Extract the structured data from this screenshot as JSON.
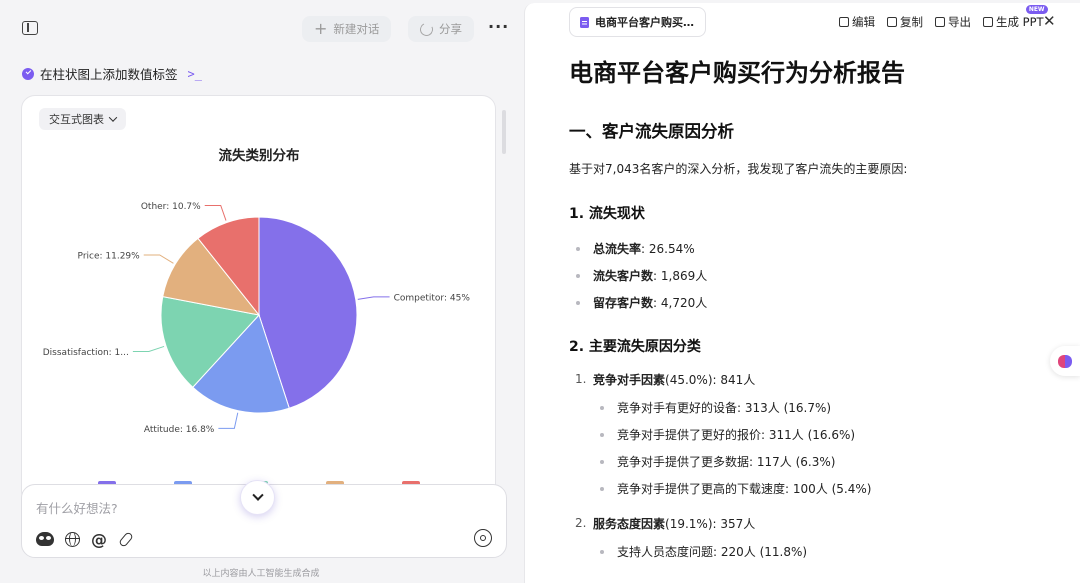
{
  "left": {
    "new_chat": "新建对话",
    "share": "分享",
    "more": "···",
    "task_title": "在柱状图上添加数值标签",
    "task_term_glyph": ">_",
    "chart_mode": "交互式图表",
    "composer_placeholder": "有什么好想法?",
    "ai_note": "以上内容由人工智能生成合成"
  },
  "chart_data": {
    "type": "pie",
    "title": "流失类别分布",
    "slices": [
      {
        "name": "Competitor",
        "label": "Competitor: 45%",
        "value": 45.0,
        "color": "#8470ea"
      },
      {
        "name": "Attitude",
        "label": "Attitude: 16.8%",
        "value": 16.8,
        "color": "#7b9bf0"
      },
      {
        "name": "Dissatisfaction",
        "label": "Dissatisfaction: 1...",
        "value": 16.2,
        "color": "#7dd4b1"
      },
      {
        "name": "Price",
        "label": "Price: 11.29%",
        "value": 11.29,
        "color": "#e2b07e"
      },
      {
        "name": "Other",
        "label": "Other: 10.7%",
        "value": 10.7,
        "color": "#e8706c"
      }
    ]
  },
  "right": {
    "tab_title": "电商平台客户购买…",
    "actions": {
      "edit": "编辑",
      "copy": "复制",
      "export": "导出",
      "ppt": "生成 PPT",
      "new_badge": "NEW"
    },
    "close": "✕",
    "doc": {
      "title": "电商平台客户购买行为分析报告",
      "h2": "一、客户流失原因分析",
      "intro": "基于对7,043名客户的深入分析，我发现了客户流失的主要原因:",
      "s1_title": "1. 流失现状",
      "s1_items": [
        {
          "label": "总流失率",
          "value": ": 26.54%"
        },
        {
          "label": "流失客户数",
          "value": ": 1,869人"
        },
        {
          "label": "留存客户数",
          "value": ": 4,720人"
        }
      ],
      "s2_title": "2. 主要流失原因分类",
      "s2_1_num": "1.",
      "s2_1_label": "竞争对手因素",
      "s2_1_value": " (45.0%): 841人",
      "s2_1_items": [
        "竞争对手有更好的设备: 313人 (16.7%)",
        "竞争对手提供了更好的报价: 311人 (16.6%)",
        "竞争对手提供了更多数据: 117人 (6.3%)",
        "竞争对手提供了更高的下载速度: 100人 (5.4%)"
      ],
      "s2_2_num": "2.",
      "s2_2_label": "服务态度因素",
      "s2_2_value": " (19.1%): 357人",
      "s2_2_items": [
        "支持人员态度问题: 220人 (11.8%)"
      ]
    }
  }
}
